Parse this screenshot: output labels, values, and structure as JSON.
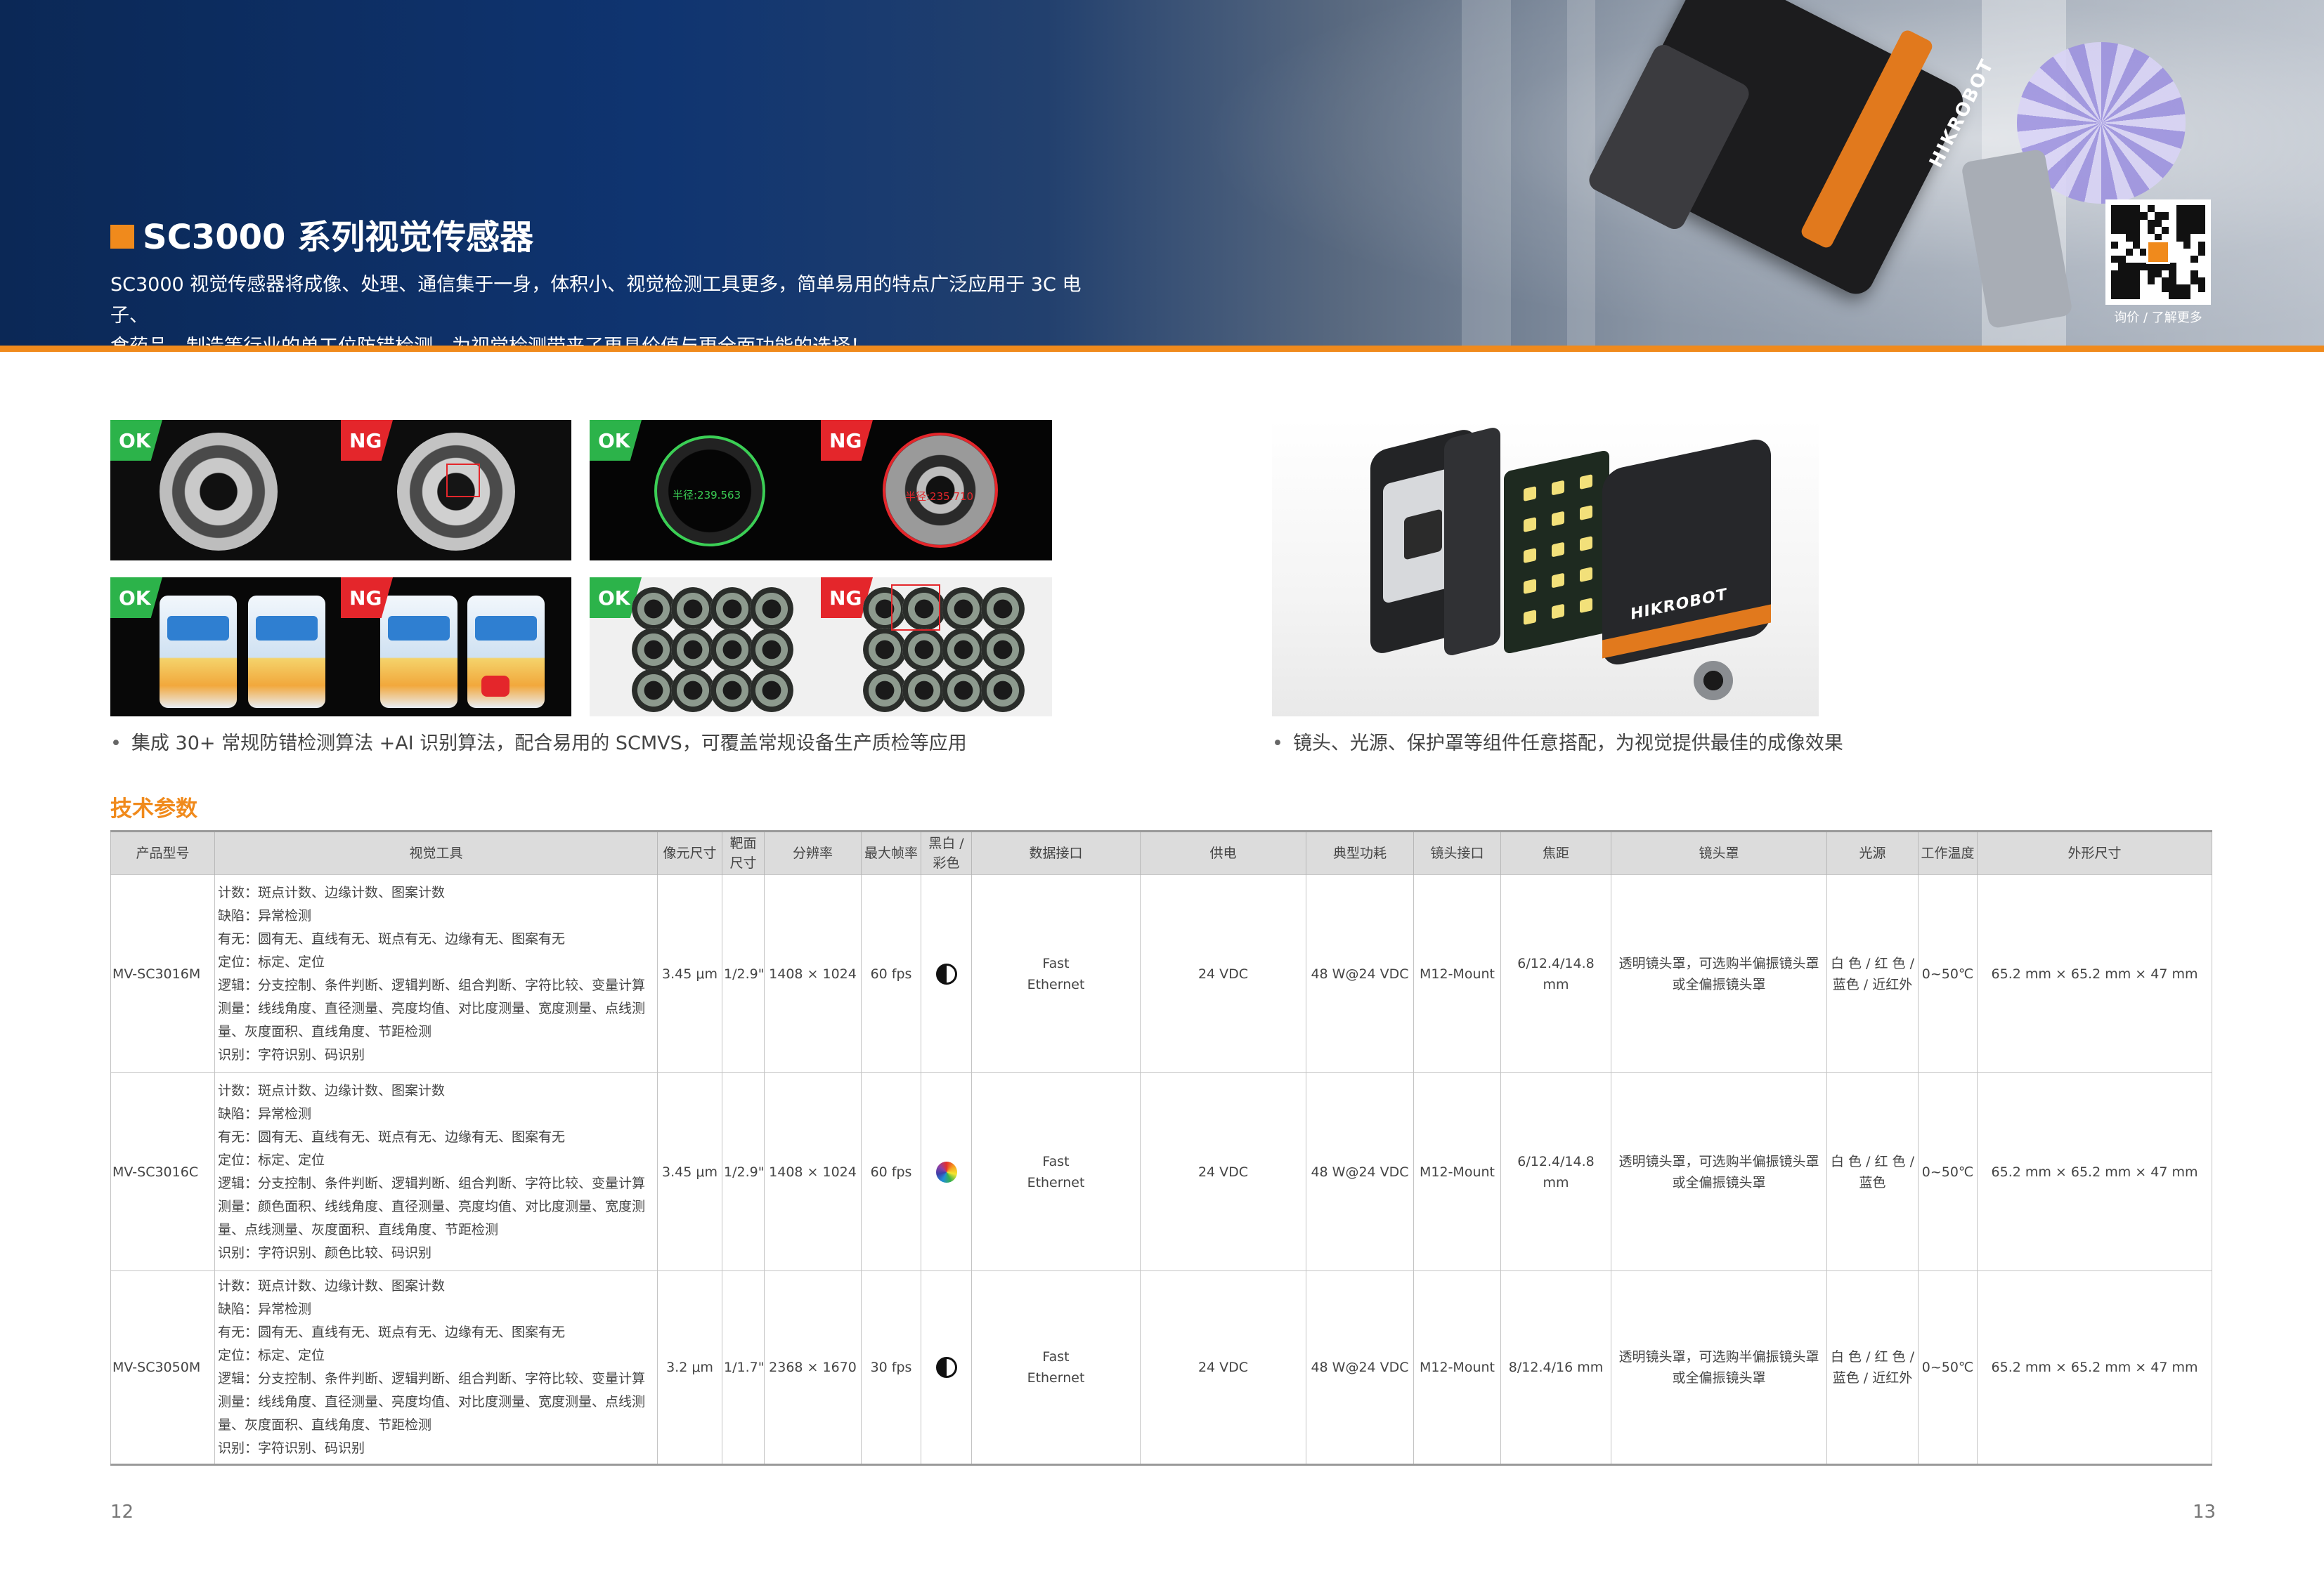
{
  "banner": {
    "title": "SC3000 系列视觉传感器",
    "desc_line1": "SC3000 视觉传感器将成像、处理、通信集于一身，体积小、视觉检测工具更多，简单易用的特点广泛应用于 3C 电子、",
    "desc_line2": "食药品、制造等行业的单工位防错检测，为视觉检测带来了更具价值与更全面功能的选择！",
    "sensor_brand": "HIKROBOT",
    "qr_caption": "询价 / 了解更多"
  },
  "samples": {
    "ok_label": "OK",
    "ng_label": "NG",
    "radius_ok": "半径:239.563",
    "radius_ng": "半径:235.710"
  },
  "captions": {
    "left": "集成 30+ 常规防错检测算法 +AI 识别算法，配合易用的 SCMVS，可覆盖常规设备生产质检等应用",
    "right": "镜头、光源、保护罩等组件任意搭配，为视觉提供最佳的成像效果"
  },
  "exploded": {
    "brand": "HIKROBOT"
  },
  "specs": {
    "title": "技术参数",
    "headers": [
      "产品型号",
      "视觉工具",
      "像元尺寸",
      "靶面尺寸",
      "分辨率",
      "最大帧率",
      "黑白 / 彩色",
      "数据接口",
      "供电",
      "典型功耗",
      "镜头接口",
      "焦距",
      "镜头罩",
      "光源",
      "工作温度",
      "外形尺寸"
    ],
    "rows": [
      {
        "model": "MV-SC3016M",
        "tools": [
          "计数：斑点计数、边缘计数、图案计数",
          "缺陷：异常检测",
          "有无：圆有无、直线有无、斑点有无、边缘有无、图案有无",
          "定位：标定、定位",
          "逻辑：分支控制、条件判断、逻辑判断、组合判断、字符比较、变量计算",
          "测量：线线角度、直径测量、亮度均值、对比度测量、宽度测量、点线测量、灰度面积、直线角度、节距检测",
          "识别：字符识别、码识别"
        ],
        "pixel": "3.45 μm",
        "sensor": "1/2.9\"",
        "resolution": "1408 × 1024",
        "fps": "60 fps",
        "color": "mono",
        "interface": [
          "Fast",
          "Ethernet"
        ],
        "power": "24 VDC",
        "consumption": "48 W@24 VDC",
        "mount": "M12-Mount",
        "focal": "6/12.4/14.8 mm",
        "cover": [
          "透明镜头罩，可选购半偏振镜头罩",
          "或全偏振镜头罩"
        ],
        "light": [
          "白 色 / 红 色 /",
          "蓝色 / 近红外"
        ],
        "temp": "0~50℃",
        "dims": "65.2 mm × 65.2 mm × 47 mm"
      },
      {
        "model": "MV-SC3016C",
        "tools": [
          "计数：斑点计数、边缘计数、图案计数",
          "缺陷：异常检测",
          "有无：圆有无、直线有无、斑点有无、边缘有无、图案有无",
          "定位：标定、定位",
          "逻辑：分支控制、条件判断、逻辑判断、组合判断、字符比较、变量计算",
          "测量：颜色面积、线线角度、直径测量、亮度均值、对比度测量、宽度测量、点线测量、灰度面积、直线角度、节距检测",
          "识别：字符识别、颜色比较、码识别"
        ],
        "pixel": "3.45 μm",
        "sensor": "1/2.9\"",
        "resolution": "1408 × 1024",
        "fps": "60 fps",
        "color": "color",
        "interface": [
          "Fast",
          "Ethernet"
        ],
        "power": "24 VDC",
        "consumption": "48 W@24 VDC",
        "mount": "M12-Mount",
        "focal": "6/12.4/14.8 mm",
        "cover": [
          "透明镜头罩，可选购半偏振镜头罩",
          "或全偏振镜头罩"
        ],
        "light": [
          "白 色 / 红 色 /",
          "蓝色"
        ],
        "temp": "0~50℃",
        "dims": "65.2 mm × 65.2 mm × 47 mm"
      },
      {
        "model": "MV-SC3050M",
        "tools": [
          "计数：斑点计数、边缘计数、图案计数",
          "缺陷：异常检测",
          "有无：圆有无、直线有无、斑点有无、边缘有无、图案有无",
          "定位：标定、定位",
          "逻辑：分支控制、条件判断、逻辑判断、组合判断、字符比较、变量计算",
          "测量：线线角度、直径测量、亮度均值、对比度测量、宽度测量、点线测量、灰度面积、直线角度、节距检测",
          "识别：字符识别、码识别"
        ],
        "pixel": "3.2 μm",
        "sensor": "1/1.7\"",
        "resolution": "2368 × 1670",
        "fps": "30 fps",
        "color": "mono",
        "interface": [
          "Fast",
          "Ethernet"
        ],
        "power": "24 VDC",
        "consumption": "48 W@24 VDC",
        "mount": "M12-Mount",
        "focal": "8/12.4/16 mm",
        "cover": [
          "透明镜头罩，可选购半偏振镜头罩",
          "或全偏振镜头罩"
        ],
        "light": [
          "白 色 / 红 色 /",
          "蓝色 / 近红外"
        ],
        "temp": "0~50℃",
        "dims": "65.2 mm × 65.2 mm × 47 mm"
      }
    ]
  },
  "pages": {
    "left": "12",
    "right": "13"
  },
  "colors": {
    "accent": "#f08a1c",
    "navy": "#0f3470",
    "ok": "#2cb34a",
    "ng": "#e4262b"
  }
}
